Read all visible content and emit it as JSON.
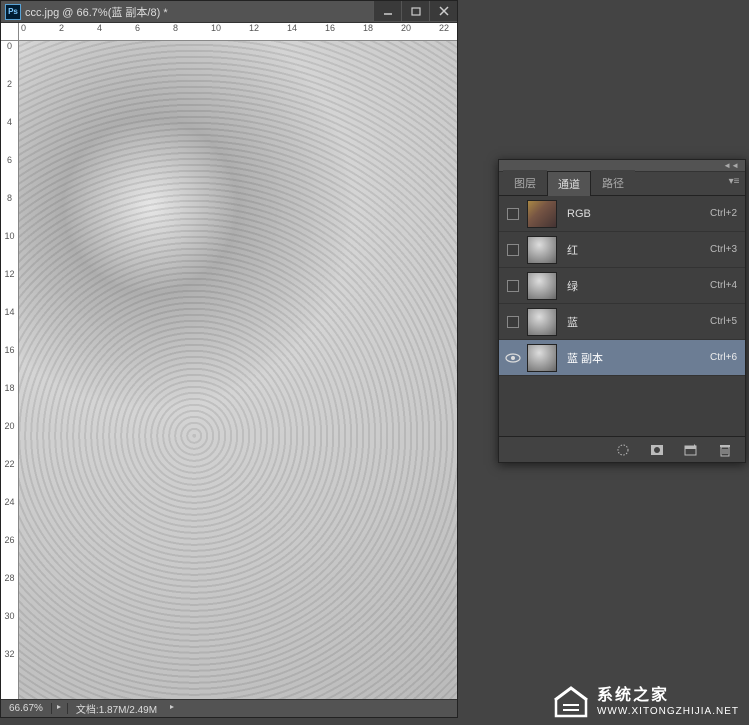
{
  "document": {
    "ps_badge": "Ps",
    "title": "ccc.jpg @ 66.7%(蓝 副本/8) *"
  },
  "ruler_h_marks": [
    "0",
    "2",
    "4",
    "6",
    "8",
    "10",
    "12",
    "14",
    "16",
    "18",
    "20",
    "22"
  ],
  "ruler_v_marks": [
    "0",
    "2",
    "4",
    "6",
    "8",
    "10",
    "12",
    "14",
    "16",
    "18",
    "20",
    "22",
    "24",
    "26",
    "28",
    "30",
    "32"
  ],
  "status": {
    "zoom": "66.67%",
    "doc": "文档:1.87M/2.49M"
  },
  "panel": {
    "collapse_glyph": "◄◄",
    "tabs": [
      {
        "label": "图层",
        "active": false
      },
      {
        "label": "通道",
        "active": true
      },
      {
        "label": "路径",
        "active": false
      }
    ],
    "menu_glyph": "▾≡",
    "channels": [
      {
        "name": "RGB",
        "shortcut": "Ctrl+2",
        "thumb": "rgb",
        "visible": false,
        "selected": false
      },
      {
        "name": "红",
        "shortcut": "Ctrl+3",
        "thumb": "gray",
        "visible": false,
        "selected": false
      },
      {
        "name": "绿",
        "shortcut": "Ctrl+4",
        "thumb": "gray",
        "visible": false,
        "selected": false
      },
      {
        "name": "蓝",
        "shortcut": "Ctrl+5",
        "thumb": "gray",
        "visible": false,
        "selected": false
      },
      {
        "name": "蓝 副本",
        "shortcut": "Ctrl+6",
        "thumb": "gray",
        "visible": true,
        "selected": true
      }
    ]
  },
  "watermark": {
    "title": "系统之家",
    "url": "WWW.XITONGZHIJIA.NET"
  }
}
